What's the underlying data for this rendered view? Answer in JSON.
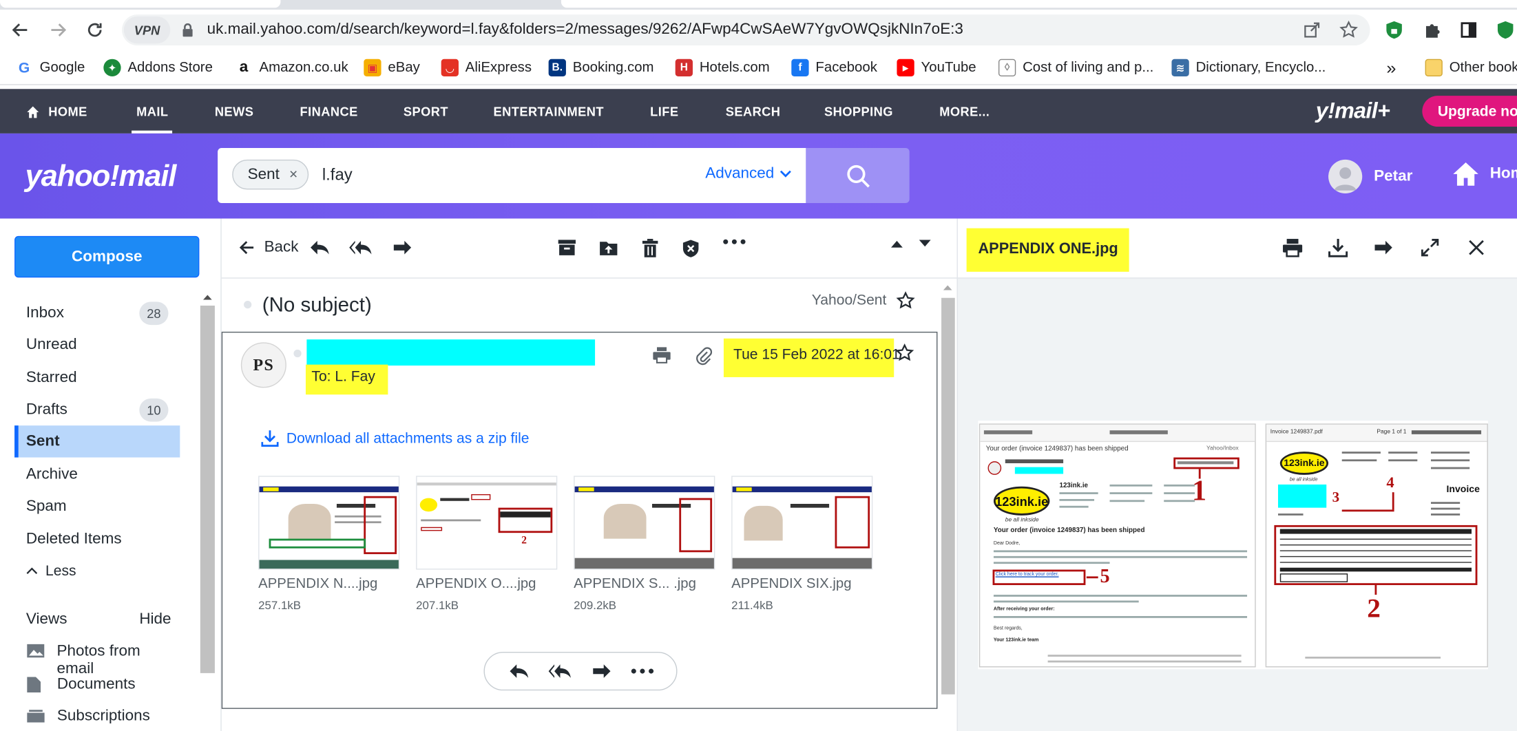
{
  "browser": {
    "vpn_label": "VPN",
    "url": "uk.mail.yahoo.com/d/search/keyword=l.fay&folders=2/messages/9262/AFwp4CwSAeW7YgvOWQsjkNIn7oE:3",
    "bookmarks": [
      {
        "label": "Google",
        "icon": "google-icon",
        "color": "#4285f4"
      },
      {
        "label": "Addons Store",
        "icon": "addons-icon",
        "color": "#1b8a3b"
      },
      {
        "label": "Amazon.co.uk",
        "icon": "amazon-icon",
        "color": "#111111"
      },
      {
        "label": "eBay",
        "icon": "ebay-icon",
        "color": "#e53238"
      },
      {
        "label": "AliExpress",
        "icon": "aliexpress-icon",
        "color": "#e43225"
      },
      {
        "label": "Booking.com",
        "icon": "booking-icon",
        "color": "#003580"
      },
      {
        "label": "Hotels.com",
        "icon": "hotels-icon",
        "color": "#d32f2f"
      },
      {
        "label": "Facebook",
        "icon": "facebook-icon",
        "color": "#1877f2"
      },
      {
        "label": "YouTube",
        "icon": "youtube-icon",
        "color": "#ff0000"
      },
      {
        "label": "Cost of living and p...",
        "icon": "shield-icon",
        "color": "#888888"
      },
      {
        "label": "Dictionary, Encyclo...",
        "icon": "dictionary-icon",
        "color": "#3a6ea5"
      }
    ],
    "bookmarks_overflow": "»",
    "other_bookmarks": "Other book"
  },
  "ynav": {
    "items": [
      "HOME",
      "MAIL",
      "NEWS",
      "FINANCE",
      "SPORT",
      "ENTERTAINMENT",
      "LIFE",
      "SEARCH",
      "SHOPPING",
      "MORE..."
    ],
    "brand": "y!mail+",
    "upgrade": "Upgrade now"
  },
  "header": {
    "logo": "yahoo!mail",
    "search_chip": "Sent",
    "search_chip_close": "×",
    "search_query": "l.fay",
    "advanced": "Advanced",
    "user_name": "Petar",
    "home_label": "Home"
  },
  "sidebar": {
    "compose": "Compose",
    "folders": [
      {
        "label": "Inbox",
        "count": "28"
      },
      {
        "label": "Unread",
        "count": ""
      },
      {
        "label": "Starred",
        "count": ""
      },
      {
        "label": "Drafts",
        "count": "10"
      },
      {
        "label": "Sent",
        "count": "",
        "selected": true
      },
      {
        "label": "Archive",
        "count": ""
      },
      {
        "label": "Spam",
        "count": ""
      },
      {
        "label": "Deleted Items",
        "count": ""
      }
    ],
    "less": "Less",
    "views_label": "Views",
    "hide_label": "Hide",
    "views": [
      {
        "label": "Photos from email",
        "icon": "photo-icon"
      },
      {
        "label": "Documents",
        "icon": "document-icon"
      },
      {
        "label": "Subscriptions",
        "icon": "subscriptions-icon"
      }
    ]
  },
  "message": {
    "back": "Back",
    "subject": "(No subject)",
    "folder": "Yahoo/Sent",
    "sender_initials": "PS",
    "to": "To: L. Fay",
    "date": "Tue 15 Feb 2022 at 16:01",
    "download_all": "Download all attachments as a zip file",
    "attachments": [
      {
        "name": "APPENDIX N....jpg",
        "size": "257.1kB"
      },
      {
        "name": "APPENDIX O....jpg",
        "size": "207.1kB"
      },
      {
        "name": "APPENDIX S... .jpg",
        "size": "209.2kB"
      },
      {
        "name": "APPENDIX SIX.jpg",
        "size": "211.4kB"
      }
    ]
  },
  "preview": {
    "filename": "APPENDIX ONE.jpg",
    "left_doc": {
      "subject": "Your order (invoice 1249837) has been shipped",
      "heading": "Your order (invoice 1249837) has been shipped",
      "store": "123ink.ie",
      "tagline": "be all inkside",
      "greeting": "Dear Dodre,",
      "track_link": "Click here to track your order.",
      "after_heading": "After receiving your order:",
      "regards": "Best regards,",
      "team": "Your 123ink.ie team",
      "folder": "Yahoo/Inbox",
      "numbers": [
        "1",
        "5"
      ]
    },
    "right_doc": {
      "filename": "Invoice 1249837.pdf",
      "page": "Page 1 of 1",
      "store": "123ink.ie",
      "tagline": "be all inkside",
      "title": "Invoice",
      "numbers": [
        "4",
        "3",
        "2"
      ]
    }
  },
  "colors": {
    "nav_bg": "#3b3f4f",
    "purple": "#7b5ff2",
    "accent_blue": "#0f69ff",
    "highlight_yellow": "#ffff33",
    "highlight_cyan": "#00ffff",
    "upgrade_pink": "#e0167e",
    "annotation_red": "#b01010"
  }
}
